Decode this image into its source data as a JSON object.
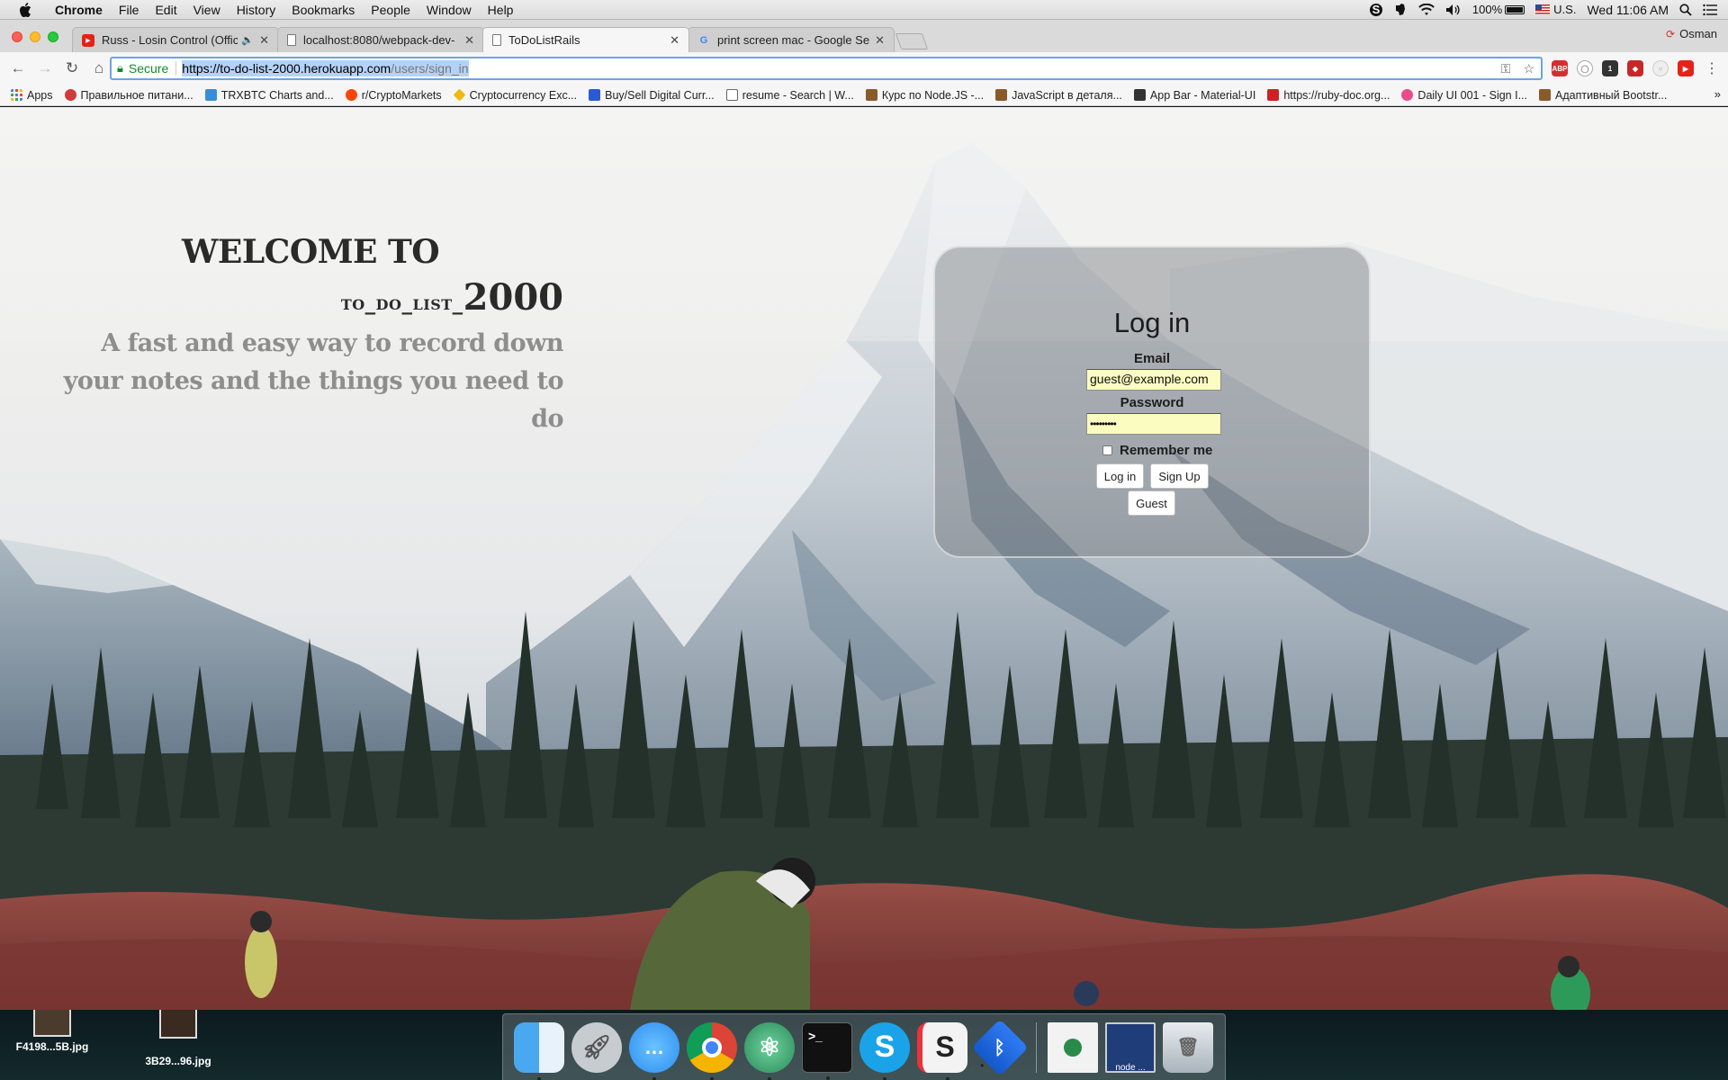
{
  "menubar": {
    "app_name": "Chrome",
    "items": [
      "File",
      "Edit",
      "View",
      "History",
      "Bookmarks",
      "People",
      "Window",
      "Help"
    ],
    "battery": "100%",
    "input_source": "U.S.",
    "clock": "Wed 11:06 AM"
  },
  "tabs": [
    {
      "title": "Russ - Losin Control (Officia",
      "icon": "youtube-icon",
      "audio": true
    },
    {
      "title": "localhost:8080/webpack-dev-",
      "icon": "page-icon"
    },
    {
      "title": "ToDoListRails",
      "icon": "page-icon",
      "active": true
    },
    {
      "title": "print screen mac - Google Sea",
      "icon": "google-icon"
    }
  ],
  "profile": {
    "name": "Osman"
  },
  "address_bar": {
    "secure_label": "Secure",
    "url_host": "https://to-do-list-2000.herokuapp.com",
    "url_path": "/users/sign_in"
  },
  "bookmarks": [
    {
      "label": "Apps",
      "color": "#4a7fd8"
    },
    {
      "label": "Правильное питани...",
      "color": "#d03a3a"
    },
    {
      "label": "TRXBTC Charts and...",
      "color": "#3a8dd6"
    },
    {
      "label": "r/CryptoMarkets",
      "color": "#ff4500"
    },
    {
      "label": "Cryptocurrency Exc...",
      "color": "#f0b90b"
    },
    {
      "label": "Buy/Sell Digital Curr...",
      "color": "#2b5ad8"
    },
    {
      "label": "resume - Search | W...",
      "color": "#666666"
    },
    {
      "label": "Курс по Node.JS -...",
      "color": "#8a5a2b"
    },
    {
      "label": "JavaScript в деталя...",
      "color": "#8a5a2b"
    },
    {
      "label": "App Bar - Material-UI",
      "color": "#333333"
    },
    {
      "label": "https://ruby-doc.org...",
      "color": "#cc2222"
    },
    {
      "label": "Daily UI 001 - Sign I...",
      "color": "#ea4c89"
    },
    {
      "label": "Адаптивный Bootstr...",
      "color": "#8a5a2b"
    }
  ],
  "hero": {
    "welcome": "WELCOME TO",
    "app_name_prefix": "to_do_list_",
    "app_name_number": "2000",
    "description": "A fast and easy way to record down your notes and the things you need to do"
  },
  "login": {
    "title": "Log in",
    "email_label": "Email",
    "email_value": "guest@example.com",
    "password_label": "Password",
    "password_value": "•••••••••",
    "remember_label": "Remember me",
    "login_button": "Log in",
    "signup_button": "Sign Up",
    "guest_button": "Guest"
  },
  "desktop_files": [
    {
      "name": "F4198...5B.jpg"
    },
    {
      "name": "3B29...96.jpg"
    }
  ],
  "dock": {
    "node_label": "node ..."
  }
}
